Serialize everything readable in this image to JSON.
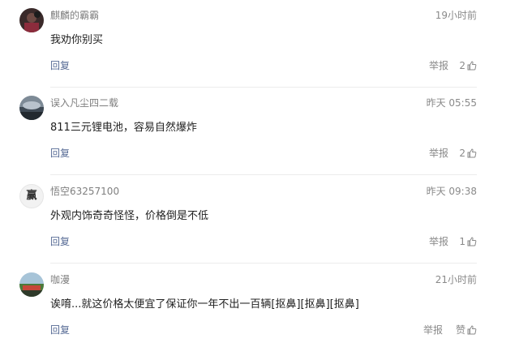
{
  "comments": [
    {
      "username": "麒麟的霸霸",
      "time": "19小时前",
      "text": "我劝你别买",
      "reply_label": "回复",
      "report_label": "举报",
      "likes": "2",
      "avatar_icon": "user-photo-avatar"
    },
    {
      "username": "误入凡尘四二载",
      "time": "昨天 05:55",
      "text": "811三元锂电池，容易自然爆炸",
      "reply_label": "回复",
      "report_label": "举报",
      "likes": "2",
      "avatar_icon": "moon-photo-avatar"
    },
    {
      "username": "悟空63257100",
      "time": "昨天 09:38",
      "text": "外观内饰奇奇怪怪，价格倒是不低",
      "reply_label": "回复",
      "report_label": "举报",
      "likes": "1",
      "avatar_text": "赢"
    },
    {
      "username": "咖漫",
      "time": "21小时前",
      "text": "诶唷...就这价格太便宜了保证你一年不出一百辆[抠鼻][抠鼻][抠鼻]",
      "reply_label": "回复",
      "report_label": "举报",
      "likes": "赞",
      "avatar_icon": "landscape-photo-avatar"
    }
  ],
  "colors": {
    "link": "#576b95",
    "meta": "#8a8a8a",
    "text": "#222222",
    "divider": "#ececec"
  }
}
